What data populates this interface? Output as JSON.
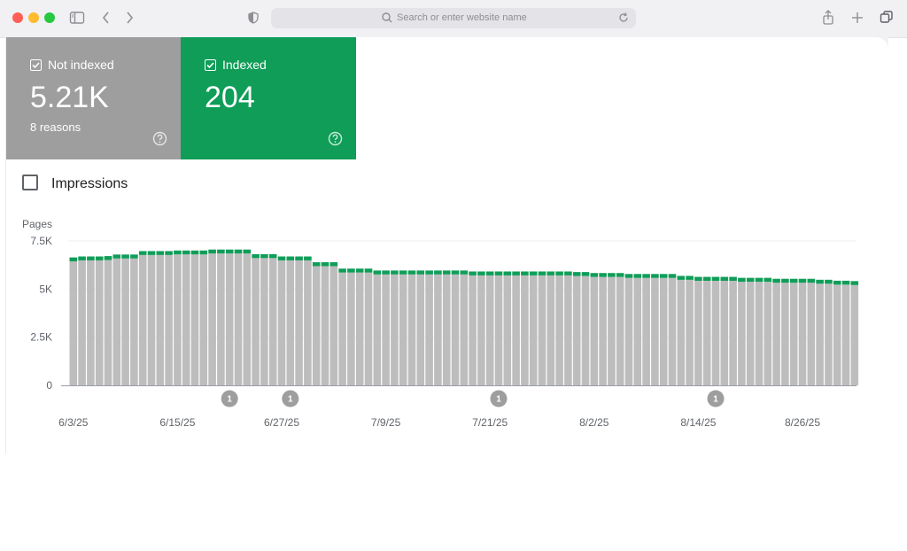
{
  "browser": {
    "address_placeholder": "Search or enter website name"
  },
  "cards": {
    "not_indexed": {
      "label": "Not indexed",
      "value": "5.21K",
      "sub": "8 reasons",
      "checked": true
    },
    "indexed": {
      "label": "Indexed",
      "value": "204",
      "checked": true
    }
  },
  "impressions": {
    "label": "Impressions",
    "checked": false
  },
  "colors": {
    "not_indexed": "#bdbdbd",
    "indexed": "#0f9d58",
    "card_not_indexed": "#9e9e9e"
  },
  "chart_data": {
    "type": "bar",
    "stacked": true,
    "ylabel": "Pages",
    "ylim": [
      0,
      7500
    ],
    "yticks": [
      "0",
      "2.5K",
      "5K",
      "7.5K"
    ],
    "ytick_values": [
      0,
      2500,
      5000,
      7500
    ],
    "xtick_labels": [
      "6/3/25",
      "6/15/25",
      "6/27/25",
      "7/9/25",
      "7/21/25",
      "8/2/25",
      "8/14/25",
      "8/26/25"
    ],
    "xtick_indices": [
      0,
      12,
      24,
      36,
      48,
      60,
      72,
      84
    ],
    "annotations": [
      {
        "index": 18,
        "label": "1"
      },
      {
        "index": 25,
        "label": "1"
      },
      {
        "index": 49,
        "label": "1"
      },
      {
        "index": 74,
        "label": "1"
      }
    ],
    "series": [
      {
        "name": "Not indexed",
        "values": [
          6440,
          6490,
          6490,
          6490,
          6510,
          6590,
          6590,
          6590,
          6770,
          6770,
          6770,
          6770,
          6800,
          6800,
          6800,
          6800,
          6850,
          6850,
          6850,
          6850,
          6850,
          6610,
          6610,
          6610,
          6490,
          6490,
          6490,
          6490,
          6190,
          6190,
          6190,
          5860,
          5860,
          5860,
          5860,
          5760,
          5760,
          5760,
          5760,
          5760,
          5760,
          5760,
          5760,
          5760,
          5760,
          5760,
          5710,
          5710,
          5710,
          5710,
          5710,
          5710,
          5710,
          5710,
          5710,
          5710,
          5710,
          5710,
          5680,
          5680,
          5630,
          5630,
          5630,
          5630,
          5580,
          5580,
          5580,
          5580,
          5580,
          5580,
          5480,
          5480,
          5430,
          5430,
          5430,
          5430,
          5430,
          5380,
          5380,
          5380,
          5380,
          5330,
          5330,
          5330,
          5330,
          5330,
          5280,
          5280,
          5230,
          5230,
          5210
        ]
      },
      {
        "name": "Indexed",
        "values": [
          204,
          204,
          204,
          204,
          204,
          204,
          204,
          204,
          204,
          204,
          204,
          204,
          204,
          204,
          204,
          204,
          204,
          204,
          204,
          204,
          204,
          204,
          204,
          204,
          204,
          204,
          204,
          204,
          204,
          204,
          204,
          204,
          204,
          204,
          204,
          204,
          204,
          204,
          204,
          204,
          204,
          204,
          204,
          204,
          204,
          204,
          204,
          204,
          204,
          204,
          204,
          204,
          204,
          204,
          204,
          204,
          204,
          204,
          204,
          204,
          204,
          204,
          204,
          204,
          204,
          204,
          204,
          204,
          204,
          204,
          204,
          204,
          204,
          204,
          204,
          204,
          204,
          204,
          204,
          204,
          204,
          204,
          204,
          204,
          204,
          204,
          204,
          204,
          204,
          204,
          204
        ]
      }
    ]
  }
}
